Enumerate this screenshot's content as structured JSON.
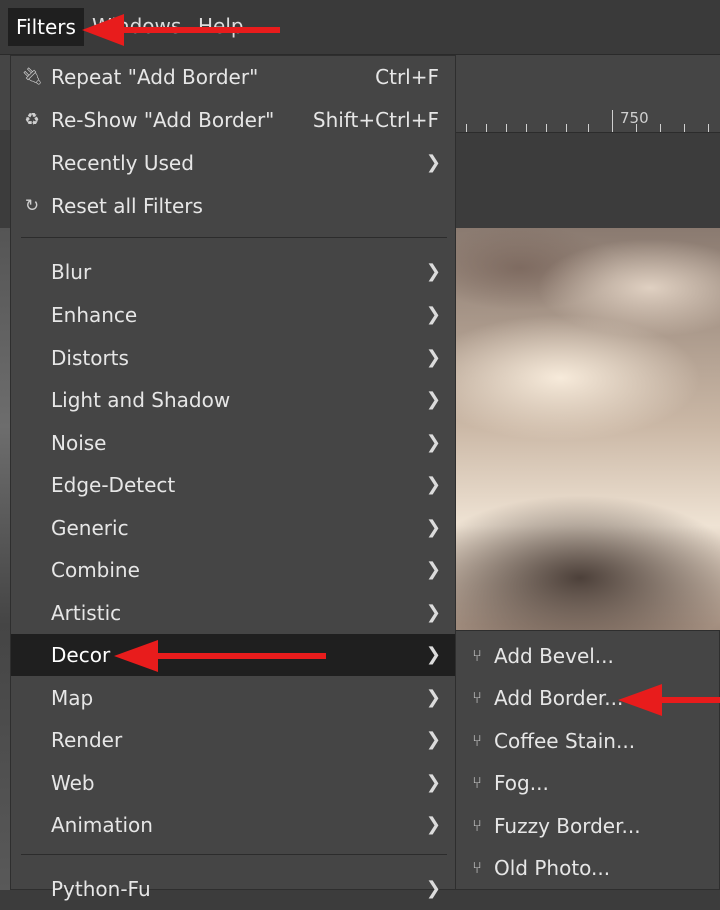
{
  "menubar": {
    "filters": "Filters",
    "windows": "Windows",
    "help": "Help"
  },
  "ruler": {
    "label": "750"
  },
  "filters_menu": {
    "repeat": {
      "label": "Repeat \"Add Border\"",
      "shortcut": "Ctrl+F"
    },
    "reshow": {
      "label": "Re-Show \"Add Border\"",
      "shortcut": "Shift+Ctrl+F"
    },
    "recently_used": "Recently Used",
    "reset": "Reset all Filters",
    "categories": [
      "Blur",
      "Enhance",
      "Distorts",
      "Light and Shadow",
      "Noise",
      "Edge-Detect",
      "Generic",
      "Combine",
      "Artistic",
      "Decor",
      "Map",
      "Render",
      "Web",
      "Animation"
    ],
    "python_fu": "Python-Fu",
    "selected": "Decor"
  },
  "decor_submenu": {
    "items": [
      "Add Bevel...",
      "Add Border...",
      "Coffee Stain...",
      "Fog...",
      "Fuzzy Border...",
      "Old Photo..."
    ]
  },
  "colors": {
    "annotation_arrow": "#e81c1c",
    "menu_bg": "#454545",
    "selected_bg": "#1f1f1f"
  }
}
